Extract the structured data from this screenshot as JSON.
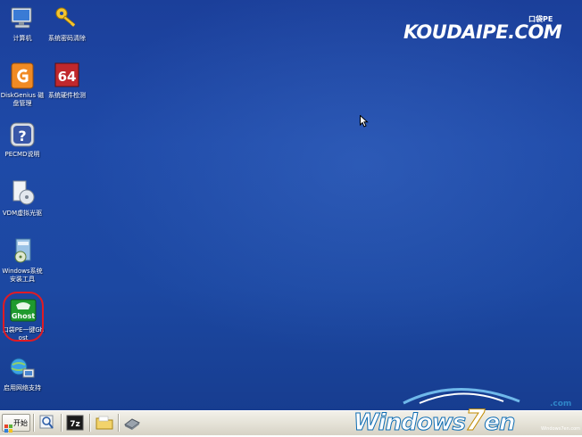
{
  "brand": {
    "logo_text": "KOUDAIPE.COM",
    "badge": "口袋PE"
  },
  "desktop_icons": [
    {
      "label": "计算机",
      "icon": "computer-icon"
    },
    {
      "label": "系统密码清除",
      "icon": "key-icon"
    },
    {
      "label": "DiskGenius 磁盘管理",
      "icon": "diskgenius-icon"
    },
    {
      "label": "系统硬件检测",
      "icon": "hardware-64-icon"
    },
    {
      "label": "PECMD说明",
      "icon": "help-icon"
    },
    {
      "label": "VDM虚拟光驱",
      "icon": "virtual-drive-icon"
    },
    {
      "label": "Windows系统安装工具",
      "icon": "windows-installer-icon"
    },
    {
      "label": "口袋PE一键Ghost",
      "icon": "ghost-icon",
      "logo_text": "Ghost"
    },
    {
      "label": "启用网络支持",
      "icon": "network-icon"
    }
  ],
  "taskbar": {
    "start_label": "开始",
    "quick_launch": [
      {
        "icon": "magnifier-icon"
      },
      {
        "icon": "7zip-icon",
        "text": "7z"
      },
      {
        "icon": "folder-icon"
      },
      {
        "icon": "drive-icon"
      }
    ]
  },
  "watermark": {
    "text_before": "Windows",
    "seven": "7",
    "text_after": "en",
    "dotcom": ".com",
    "small": "Windows7en.com"
  },
  "colors": {
    "desktop_blue": "#1f4aa8",
    "highlight_ring": "#e01b24",
    "taskbar": "#e4e1d6"
  }
}
